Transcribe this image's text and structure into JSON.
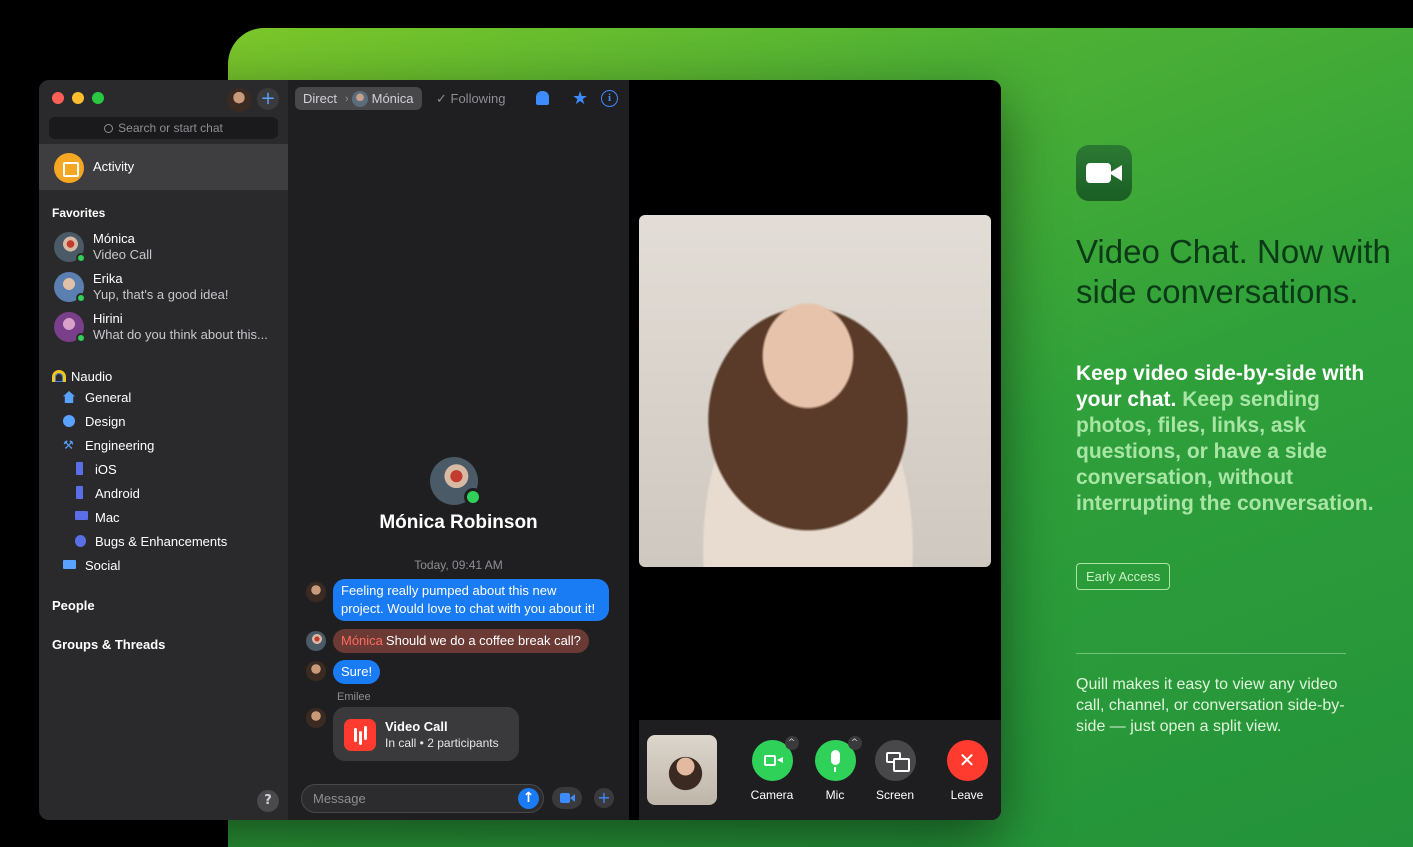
{
  "sidebar": {
    "search_placeholder": "Search or start chat",
    "activity_label": "Activity",
    "favorites_title": "Favorites",
    "favorites": [
      {
        "name": "Mónica",
        "preview": "Video Call"
      },
      {
        "name": "Erika",
        "preview": "Yup, that's a good idea!"
      },
      {
        "name": "Hirini",
        "preview": "What do you think about this..."
      }
    ],
    "team_name": "Naudio",
    "channels": [
      {
        "label": "General",
        "icon": "house-icon"
      },
      {
        "label": "Design",
        "icon": "palette-icon"
      },
      {
        "label": "Engineering",
        "icon": "hammer-icon"
      },
      {
        "label": "iOS",
        "icon": "phone-icon"
      },
      {
        "label": "Android",
        "icon": "phone-icon"
      },
      {
        "label": "Mac",
        "icon": "desktop-icon"
      },
      {
        "label": "Bugs & Enhancements",
        "icon": "bug-icon"
      },
      {
        "label": "Social",
        "icon": "laptop-icon"
      }
    ],
    "people_title": "People",
    "groups_title": "Groups & Threads",
    "help_label": "?"
  },
  "chat": {
    "breadcrumb_direct": "Direct",
    "breadcrumb_contact": "Mónica",
    "following_label": "✓ Following",
    "contact_name": "Mónica Robinson",
    "timestamp": "Today, 09:41 AM",
    "messages": [
      {
        "text": "Feeling really pumped about this new project. Would love to chat with you about it!"
      },
      {
        "sender": "Mónica",
        "text": "Should we do a coffee break call?"
      },
      {
        "text": "Sure!"
      }
    ],
    "sender_label": "Emilee",
    "call_card": {
      "title": "Video Call",
      "subtitle": "In call • 2 participants"
    },
    "composer_placeholder": "Message"
  },
  "call_controls": {
    "camera": "Camera",
    "mic": "Mic",
    "screen": "Screen",
    "leave": "Leave"
  },
  "marketing": {
    "headline": "Video Chat. Now with side conversations.",
    "subhead_bold": "Keep video side-by-side with your chat.",
    "subhead_rest": " Keep sending photos, files, links, ask questions, or have a side conversation, without interrupting the conversation.",
    "early_access": "Early Access",
    "footnote": "Quill makes it easy to view any video call, channel, or conversation side-by-side — just open a split view."
  },
  "colors": {
    "accent_blue": "#1a7cf5",
    "online_green": "#30d158",
    "leave_red": "#ff3b30",
    "activity_orange": "#f5a623"
  }
}
